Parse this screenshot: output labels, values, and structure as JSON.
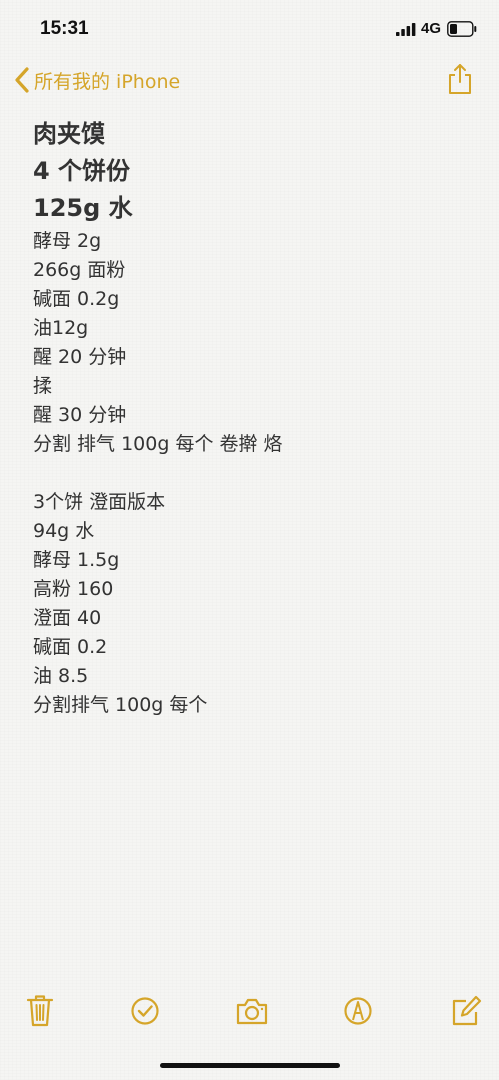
{
  "status_bar": {
    "time": "15:31",
    "network": "4G"
  },
  "nav": {
    "back_label": "所有我的 iPhone",
    "accent_color": "#d5a52a"
  },
  "note": {
    "titles": [
      "肉夹馍",
      "4 个饼份",
      "125g 水"
    ],
    "lines": [
      "酵母 2g",
      "266g 面粉",
      "碱面 0.2g",
      "油12g",
      "醒 20 分钟",
      "揉",
      "醒 30 分钟",
      "分割 排气 100g 每个 卷擀 烙",
      "",
      "3个饼 澄面版本",
      "94g 水",
      "酵母 1.5g",
      "高粉 160",
      "澄面 40",
      "碱面 0.2",
      "油 8.5",
      "分割排气 100g 每个"
    ]
  },
  "toolbar": {
    "icons": [
      "trash-icon",
      "checklist-icon",
      "camera-icon",
      "markup-icon",
      "compose-icon"
    ]
  }
}
